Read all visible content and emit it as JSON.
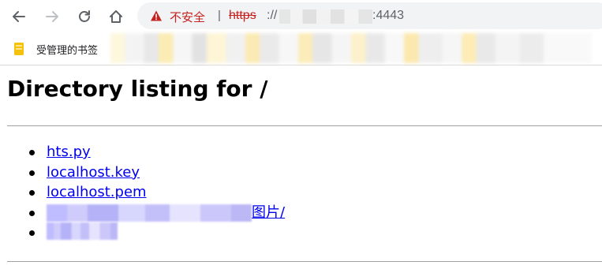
{
  "browser": {
    "security_label": "不安全",
    "divider": "|",
    "url_scheme": "https",
    "url_separator": "://",
    "url_port": ":4443",
    "icons": {
      "back": "arrow-left-icon",
      "forward": "arrow-right-icon",
      "reload": "reload-icon",
      "home": "home-icon",
      "warning": "warning-triangle-icon"
    },
    "colors": {
      "insecure": "#c5221f",
      "link": "#0000ee",
      "omnibox_bg": "#f1f3f4"
    }
  },
  "bookmarks": {
    "managed_folder_label": "受管理的书签"
  },
  "page": {
    "heading": "Directory listing for /",
    "files": [
      {
        "name": "hts.py"
      },
      {
        "name": "localhost.key"
      },
      {
        "name": "localhost.pem"
      },
      {
        "name": "图片/"
      },
      {
        "name": ""
      }
    ]
  }
}
